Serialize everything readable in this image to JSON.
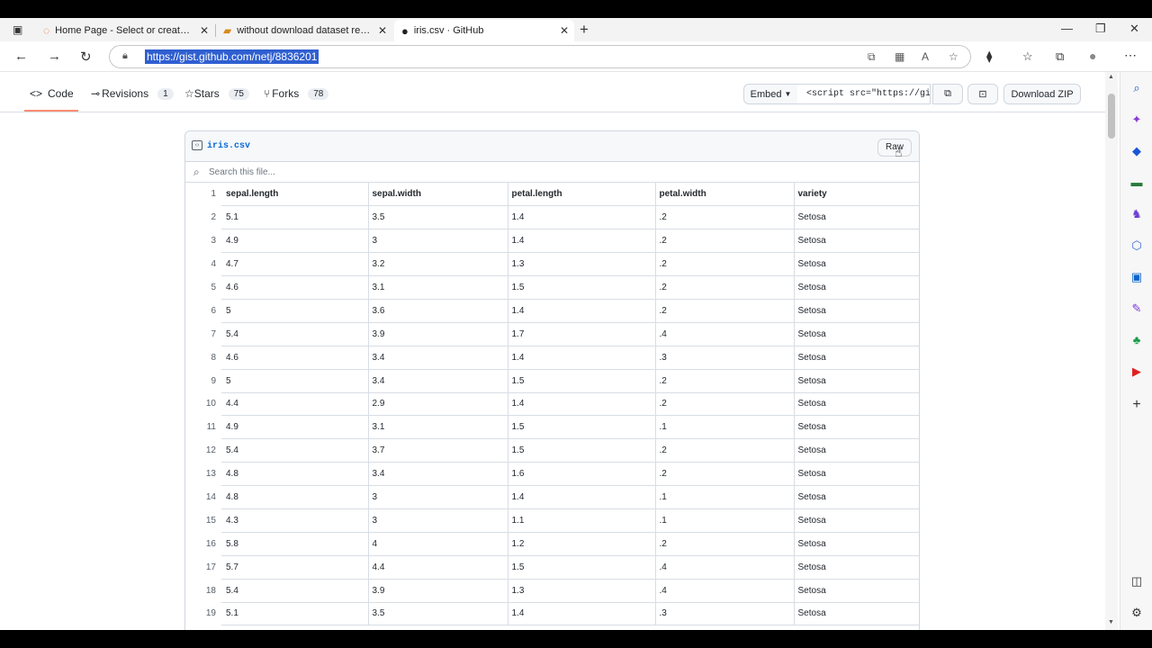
{
  "browser": {
    "tabs": [
      {
        "title": "Home Page - Select or create a n",
        "icon": "spinner-icon"
      },
      {
        "title": "without download dataset read c",
        "icon": "page-icon"
      },
      {
        "title": "iris.csv · GitHub",
        "icon": "github-icon"
      }
    ],
    "url": "https://gist.github.com/netj/8836201"
  },
  "gist": {
    "nav": {
      "code": "Code",
      "revisions": "Revisions",
      "revisions_count": "1",
      "stars": "Stars",
      "stars_count": "75",
      "forks": "Forks",
      "forks_count": "78"
    },
    "embed_label": "Embed",
    "embed_value": "<script src=\"https://gis",
    "download_label": "Download ZIP",
    "file": {
      "name": "iris.csv",
      "raw_label": "Raw",
      "search_placeholder": "Search this file..."
    },
    "header": [
      "sepal.length",
      "sepal.width",
      "petal.length",
      "petal.width",
      "variety"
    ],
    "rows": [
      [
        "5.1",
        "3.5",
        "1.4",
        ".2",
        "Setosa"
      ],
      [
        "4.9",
        "3",
        "1.4",
        ".2",
        "Setosa"
      ],
      [
        "4.7",
        "3.2",
        "1.3",
        ".2",
        "Setosa"
      ],
      [
        "4.6",
        "3.1",
        "1.5",
        ".2",
        "Setosa"
      ],
      [
        "5",
        "3.6",
        "1.4",
        ".2",
        "Setosa"
      ],
      [
        "5.4",
        "3.9",
        "1.7",
        ".4",
        "Setosa"
      ],
      [
        "4.6",
        "3.4",
        "1.4",
        ".3",
        "Setosa"
      ],
      [
        "5",
        "3.4",
        "1.5",
        ".2",
        "Setosa"
      ],
      [
        "4.4",
        "2.9",
        "1.4",
        ".2",
        "Setosa"
      ],
      [
        "4.9",
        "3.1",
        "1.5",
        ".1",
        "Setosa"
      ],
      [
        "5.4",
        "3.7",
        "1.5",
        ".2",
        "Setosa"
      ],
      [
        "4.8",
        "3.4",
        "1.6",
        ".2",
        "Setosa"
      ],
      [
        "4.8",
        "3",
        "1.4",
        ".1",
        "Setosa"
      ],
      [
        "4.3",
        "3",
        "1.1",
        ".1",
        "Setosa"
      ],
      [
        "5.8",
        "4",
        "1.2",
        ".2",
        "Setosa"
      ],
      [
        "5.7",
        "4.4",
        "1.5",
        ".4",
        "Setosa"
      ],
      [
        "5.4",
        "3.9",
        "1.3",
        ".4",
        "Setosa"
      ],
      [
        "5.1",
        "3.5",
        "1.4",
        ".3",
        "Setosa"
      ]
    ]
  }
}
